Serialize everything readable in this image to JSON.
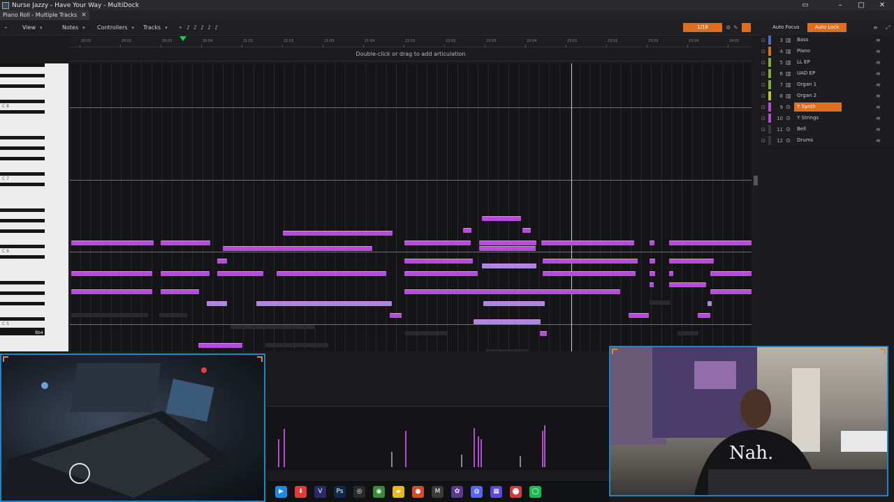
{
  "window": {
    "title": "Nurse Jazzy - Have Your Way - MultiDock"
  },
  "tab": {
    "label": "Piano Roll - Multiple Tracks"
  },
  "toolbar": {
    "view": "View",
    "notes": "Notes",
    "controllers": "Controllers",
    "tracks": "Tracks",
    "snap_value": "1/16",
    "auto_focus": "Auto Focus",
    "auto_lock": "Auto Lock"
  },
  "ruler": {
    "labels": [
      "20:01",
      "20:02",
      "20:03",
      "20:04",
      "21:01",
      "21:02",
      "21:03",
      "21:04",
      "22:01",
      "22:02",
      "22:03",
      "22:04",
      "23:01",
      "23:02",
      "23:03",
      "23:04",
      "24:01"
    ]
  },
  "articulation_hint": "Double-click or drag to add articulation",
  "keyboard": {
    "octave_labels": [
      "C 8",
      "C 7",
      "C 6",
      "C 5"
    ],
    "highlighted_key": "Bb4"
  },
  "tracks": [
    {
      "num": "3",
      "name": "Bass",
      "color": "#4a6fc2",
      "selected": false
    },
    {
      "num": "4",
      "name": "Piano",
      "color": "#e06e1f",
      "selected": false
    },
    {
      "num": "5",
      "name": "LL EP",
      "color": "#7ab23a",
      "selected": false
    },
    {
      "num": "6",
      "name": "UAD EP",
      "color": "#7ab23a",
      "selected": false
    },
    {
      "num": "7",
      "name": "Organ 1",
      "color": "#7ab23a",
      "selected": false
    },
    {
      "num": "8",
      "name": "Organ 2",
      "color": "#b8c43a",
      "selected": false
    },
    {
      "num": "9",
      "name": "Y Synth",
      "color": "#b64dd8",
      "selected": true
    },
    {
      "num": "10",
      "name": "Y Strings",
      "color": "#b64dd8",
      "selected": false
    },
    {
      "num": "11",
      "name": "Bell",
      "color": "#3a3a3a",
      "selected": false
    },
    {
      "num": "12",
      "name": "Drums",
      "color": "#3a3a3a",
      "selected": false
    }
  ],
  "colors": {
    "accent": "#e06e1f",
    "note": "#b64dd8",
    "webcam_border": "#1f87c8"
  },
  "webcam": {
    "shirt_text": "Nah."
  },
  "taskbar_icons": [
    "play-app-icon",
    "download-app-icon",
    "vegas-app-icon",
    "photoshop-app-icon",
    "obs-app-icon",
    "chrome-app-icon",
    "folder-app-icon",
    "record-app-icon",
    "mail-app-icon",
    "fingerprint-app-icon",
    "discord-app-icon",
    "grid-app-icon",
    "maps-app-icon",
    "spotify-app-icon"
  ]
}
